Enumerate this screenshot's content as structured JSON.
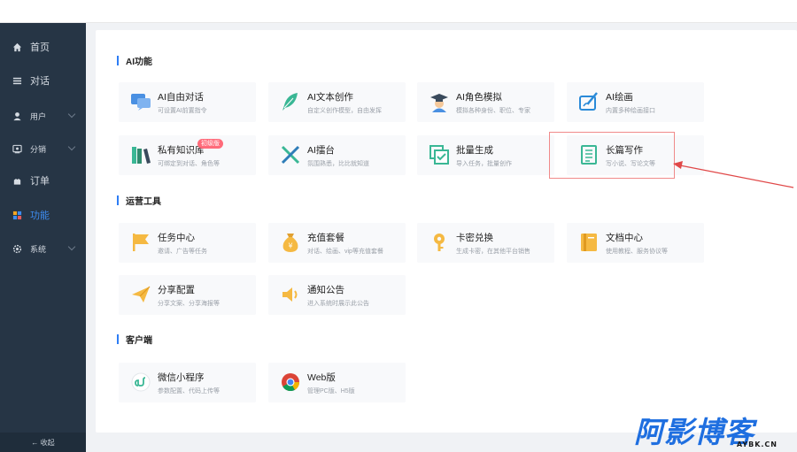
{
  "sidebar": {
    "items": [
      {
        "label": "首页",
        "icon": "home-icon"
      },
      {
        "label": "对话",
        "icon": "list-icon"
      },
      {
        "label": "用户",
        "icon": "user-icon"
      },
      {
        "label": "分销",
        "icon": "distribution-icon"
      },
      {
        "label": "订单",
        "icon": "order-icon"
      },
      {
        "label": "功能",
        "icon": "apps-icon"
      },
      {
        "label": "系统",
        "icon": "gear-icon"
      }
    ],
    "collapse_label": "← 收起",
    "active_color": "#3d8cf0"
  },
  "sections": {
    "ai": {
      "title": "AI功能",
      "cards": [
        {
          "title": "AI自由对话",
          "desc": "可设置AI前置指令",
          "icon": "chat-bubble-icon"
        },
        {
          "title": "AI文本创作",
          "desc": "自定义创作模型，自由发挥",
          "icon": "feather-icon"
        },
        {
          "title": "AI角色模拟",
          "desc": "模拟各种身份、职位、专家",
          "icon": "graduate-icon"
        },
        {
          "title": "AI绘画",
          "desc": "内置多种绘画接口",
          "icon": "paint-icon"
        },
        {
          "title": "私有知识库",
          "desc": "可绑定到对话、角色等",
          "icon": "books-icon",
          "badge": "初级版"
        },
        {
          "title": "AI擂台",
          "desc": "氛围熟悉，比比就知道",
          "icon": "swords-icon"
        },
        {
          "title": "批量生成",
          "desc": "导入任务，批量创作",
          "icon": "batch-icon"
        },
        {
          "title": "长篇写作",
          "desc": "写小说、写论文等",
          "icon": "document-icon"
        }
      ]
    },
    "ops": {
      "title": "运营工具",
      "cards": [
        {
          "title": "任务中心",
          "desc": "邀请、广告等任务",
          "icon": "flag-icon"
        },
        {
          "title": "充值套餐",
          "desc": "对话、绘画、vip等充值套餐",
          "icon": "money-bag-icon"
        },
        {
          "title": "卡密兑换",
          "desc": "生成卡密，在其他平台销售",
          "icon": "key-icon"
        },
        {
          "title": "文档中心",
          "desc": "使用教程、服务协议等",
          "icon": "book-icon"
        },
        {
          "title": "分享配置",
          "desc": "分享文案、分享海报等",
          "icon": "paper-plane-icon"
        },
        {
          "title": "通知公告",
          "desc": "进入系统时展示此公告",
          "icon": "speaker-icon"
        }
      ]
    },
    "client": {
      "title": "客户端",
      "cards": [
        {
          "title": "微信小程序",
          "desc": "参数配置、代码上传等",
          "icon": "miniprogram-icon"
        },
        {
          "title": "Web版",
          "desc": "管理PC版、H5版",
          "icon": "chrome-icon"
        }
      ]
    }
  },
  "watermark": {
    "main": "阿影博客",
    "sub": "AYBK.CN"
  },
  "colors": {
    "accent": "#2d7df5",
    "sidebar_bg": "#263545",
    "highlight": "#f08a8a",
    "arrow": "#e04848"
  }
}
